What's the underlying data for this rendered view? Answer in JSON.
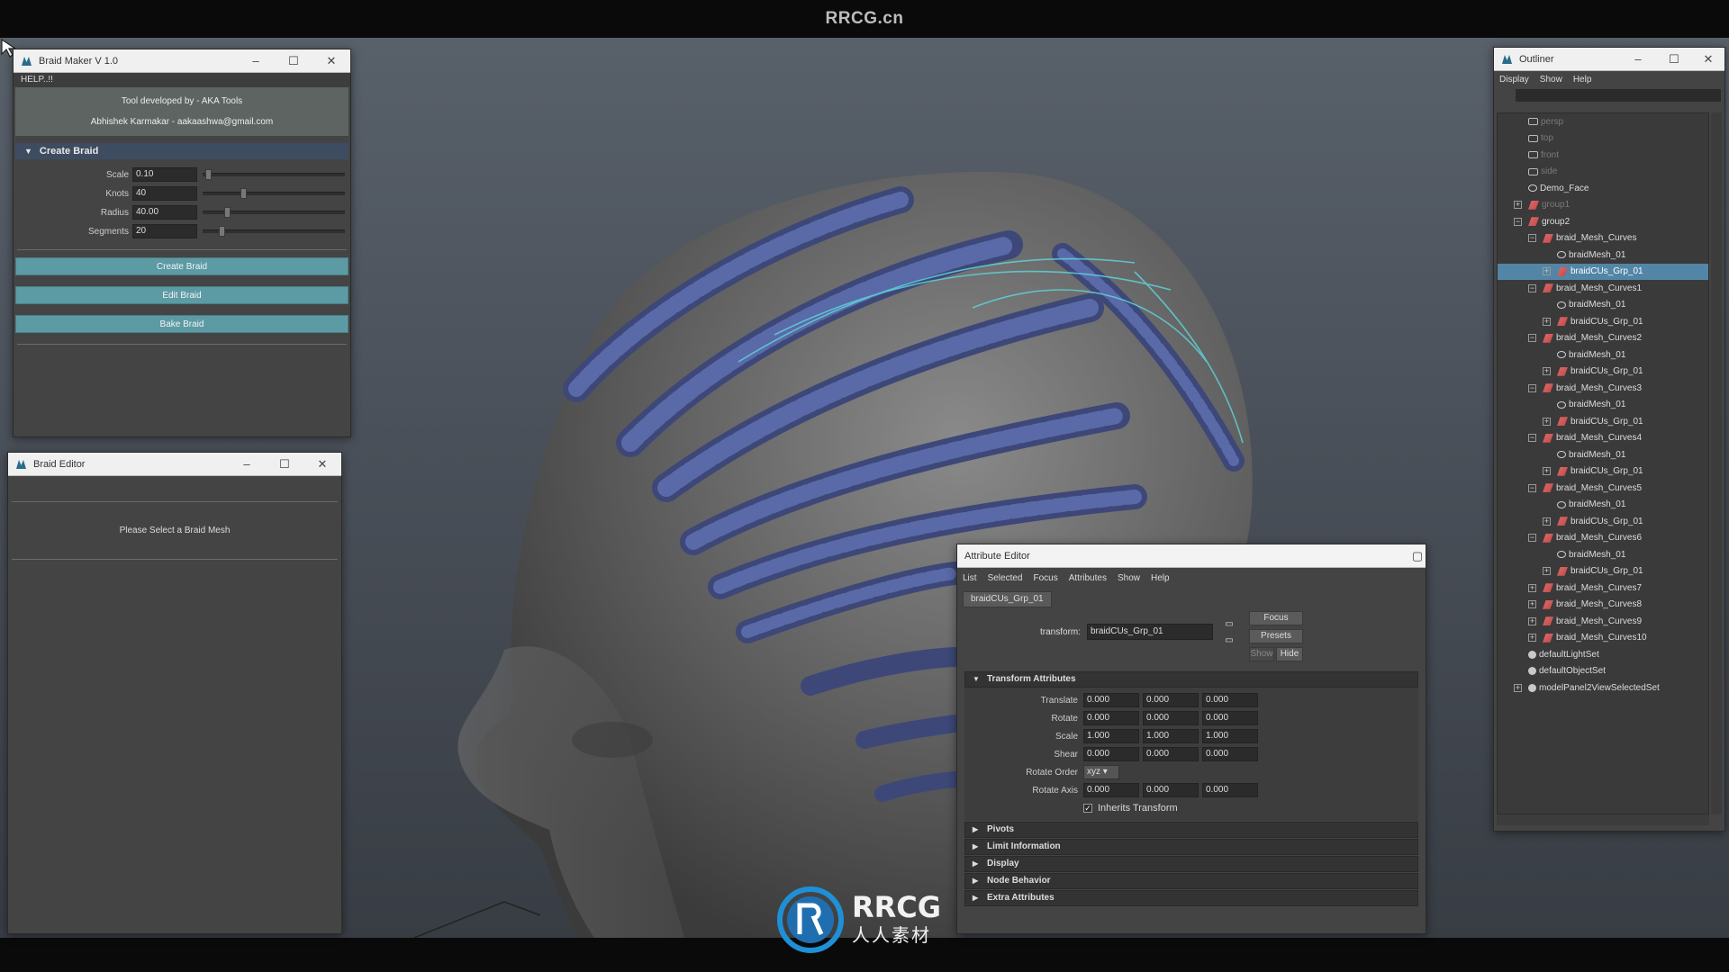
{
  "banner": {
    "site": "RRCG.cn"
  },
  "braid_maker": {
    "title": "Braid Maker V 1.0",
    "help": "HELP..!!",
    "credit_line1": "Tool developed by - AKA Tools",
    "credit_line2": "Abhishek Karmakar - aakaashwa@gmail.com",
    "section": "Create Braid",
    "fields": [
      {
        "label": "Scale",
        "value": "0.10",
        "level": 0.02
      },
      {
        "label": "Knots",
        "value": "40",
        "level": 0.28
      },
      {
        "label": "Radius",
        "value": "40.00",
        "level": 0.16
      },
      {
        "label": "Segments",
        "value": "20",
        "level": 0.12
      }
    ],
    "buttons": {
      "create": "Create Braid",
      "edit": "Edit Braid",
      "bake": "Bake Braid"
    }
  },
  "braid_editor": {
    "title": "Braid Editor",
    "message": "Please Select a Braid Mesh"
  },
  "outliner": {
    "title": "Outliner",
    "menu": [
      "Display",
      "Show",
      "Help"
    ],
    "items": [
      {
        "label": "persp",
        "icon": "camera-icon"
      },
      {
        "label": "top",
        "icon": "camera-icon"
      },
      {
        "label": "front",
        "icon": "camera-icon"
      },
      {
        "label": "side",
        "icon": "camera-icon"
      },
      {
        "label": "Demo_Face",
        "icon": "mesh-icon"
      },
      {
        "label": "group1",
        "icon": "group-icon"
      },
      {
        "label": "group2",
        "icon": "group-icon"
      },
      {
        "label": "braid_Mesh_Curves",
        "icon": "group-icon"
      },
      {
        "label": "braidMesh_01",
        "icon": "mesh-icon"
      },
      {
        "label": "braidCUs_Grp_01",
        "icon": "group-icon"
      },
      {
        "label": "braid_Mesh_Curves1",
        "icon": "group-icon"
      },
      {
        "label": "braidMesh_01",
        "icon": "mesh-icon"
      },
      {
        "label": "braidCUs_Grp_01",
        "icon": "group-icon"
      },
      {
        "label": "braid_Mesh_Curves2",
        "icon": "group-icon"
      },
      {
        "label": "braidMesh_01",
        "icon": "mesh-icon"
      },
      {
        "label": "braidCUs_Grp_01",
        "icon": "group-icon"
      },
      {
        "label": "braid_Mesh_Curves3",
        "icon": "group-icon"
      },
      {
        "label": "braidMesh_01",
        "icon": "mesh-icon"
      },
      {
        "label": "braidCUs_Grp_01",
        "icon": "group-icon"
      },
      {
        "label": "braid_Mesh_Curves4",
        "icon": "group-icon"
      },
      {
        "label": "braidMesh_01",
        "icon": "mesh-icon"
      },
      {
        "label": "braidCUs_Grp_01",
        "icon": "group-icon"
      },
      {
        "label": "braid_Mesh_Curves5",
        "icon": "group-icon"
      },
      {
        "label": "braidMesh_01",
        "icon": "mesh-icon"
      },
      {
        "label": "braidCUs_Grp_01",
        "icon": "group-icon"
      },
      {
        "label": "braid_Mesh_Curves6",
        "icon": "group-icon"
      },
      {
        "label": "braidMesh_01",
        "icon": "mesh-icon"
      },
      {
        "label": "braidCUs_Grp_01",
        "icon": "group-icon"
      },
      {
        "label": "braid_Mesh_Curves7",
        "icon": "group-icon"
      },
      {
        "label": "braid_Mesh_Curves8",
        "icon": "group-icon"
      },
      {
        "label": "braid_Mesh_Curves9",
        "icon": "group-icon"
      },
      {
        "label": "braid_Mesh_Curves10",
        "icon": "group-icon"
      },
      {
        "label": "defaultLightSet",
        "icon": "set-icon"
      },
      {
        "label": "defaultObjectSet",
        "icon": "set-icon"
      },
      {
        "label": "modelPanel2ViewSelectedSet",
        "icon": "set-icon"
      }
    ],
    "selected": "braidCUs_Grp_01"
  },
  "attribute_editor": {
    "title": "Attribute Editor",
    "menu": [
      "List",
      "Selected",
      "Focus",
      "Attributes",
      "Show",
      "Help"
    ],
    "tab": "braidCUs_Grp_01",
    "transform_label": "transform:",
    "transform_value": "braidCUs_Grp_01",
    "buttons": {
      "focus": "Focus",
      "presets": "Presets",
      "show": "Show",
      "hide": "Hide"
    },
    "section": "Transform Attributes",
    "rows": [
      {
        "label": "Translate",
        "values": [
          "0.000",
          "0.000",
          "0.000"
        ]
      },
      {
        "label": "Rotate",
        "values": [
          "0.000",
          "0.000",
          "0.000"
        ]
      },
      {
        "label": "Scale",
        "values": [
          "1.000",
          "1.000",
          "1.000"
        ]
      },
      {
        "label": "Shear",
        "values": [
          "0.000",
          "0.000",
          "0.000"
        ]
      }
    ],
    "rotate_order_label": "Rotate Order",
    "rotate_order": "xyz",
    "rotate_axis_label": "Rotate Axis",
    "rotate_axis": [
      "0.000",
      "0.000",
      "0.000"
    ],
    "inherits": "Inherits Transform",
    "collapsed": [
      "Pivots",
      "Limit Information",
      "Display",
      "Node Behavior",
      "Extra Attributes"
    ]
  },
  "watermark": {
    "brand": "RRCG",
    "sub": "人人素材"
  },
  "colors": {
    "button_teal": "#5c9aa4",
    "selection_blue": "#5285a6",
    "braid_blue": "#4e5c95"
  }
}
